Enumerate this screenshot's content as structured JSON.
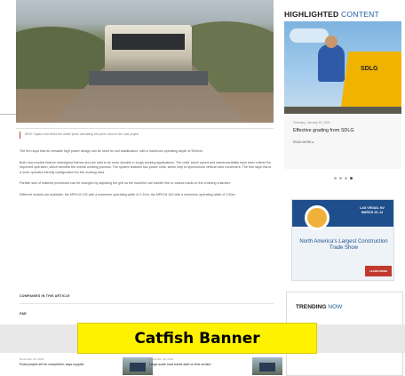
{
  "sidebar": {
    "heading_bold": "HIGHLIGHTED",
    "heading_light": "CONTENT",
    "highlight": {
      "date": "February | January 19, 2023",
      "title": "Effective grading from SDLG",
      "more": "READ MORE ▸",
      "brand": "SDLG"
    },
    "carousel_dots": 4,
    "carousel_active": 4,
    "ad": {
      "dates": "LAS VEGAS, NV MARCH 10–14",
      "title": "North America's Largest Construction Trade Show",
      "button": "LEARN MORE"
    },
    "trending_bold": "TRENDING",
    "trending_light": "NOW",
    "trending_item": "agreement for China and Africa"
  },
  "article": {
    "caption": "NEW: Caption text below the article photo describing the paver used on the road project",
    "paragraphs": [
      "The firm says that its versatile high power design can be used for soil stabilization, with a maximum operating depth of 500mm.",
      "Both new models feature redesigned frames and are said to be more durable in tough working applications. The units' travel speed and maneuverability have been refined for improved operation, which benefits the overall working process. The system features two power units, which help to synchronize vertical rotor movement. The firm says this is a more operator-friendly configuration for the working area.",
      "Particle size of material processed can be changed by adjusting the grill so the machine can handle fine or coarse loads on the crushing chamber.",
      "Different models are available: the MPH-M 125 with a maximum operating width of 2.10m; the MPH-M 150 with a maximum operating width of 2.50m."
    ],
    "companies_label": "COMPANIES IN THIS ARTICLE",
    "company_tag": "FAE"
  },
  "banner": {
    "label": "Catfish Banner"
  },
  "related": [
    {
      "date": "November 24, 2023",
      "title": "Road project set for completion, says supplier"
    },
    {
      "date": "November 28, 2023",
      "title": "Large-scale road works start on first section"
    }
  ]
}
